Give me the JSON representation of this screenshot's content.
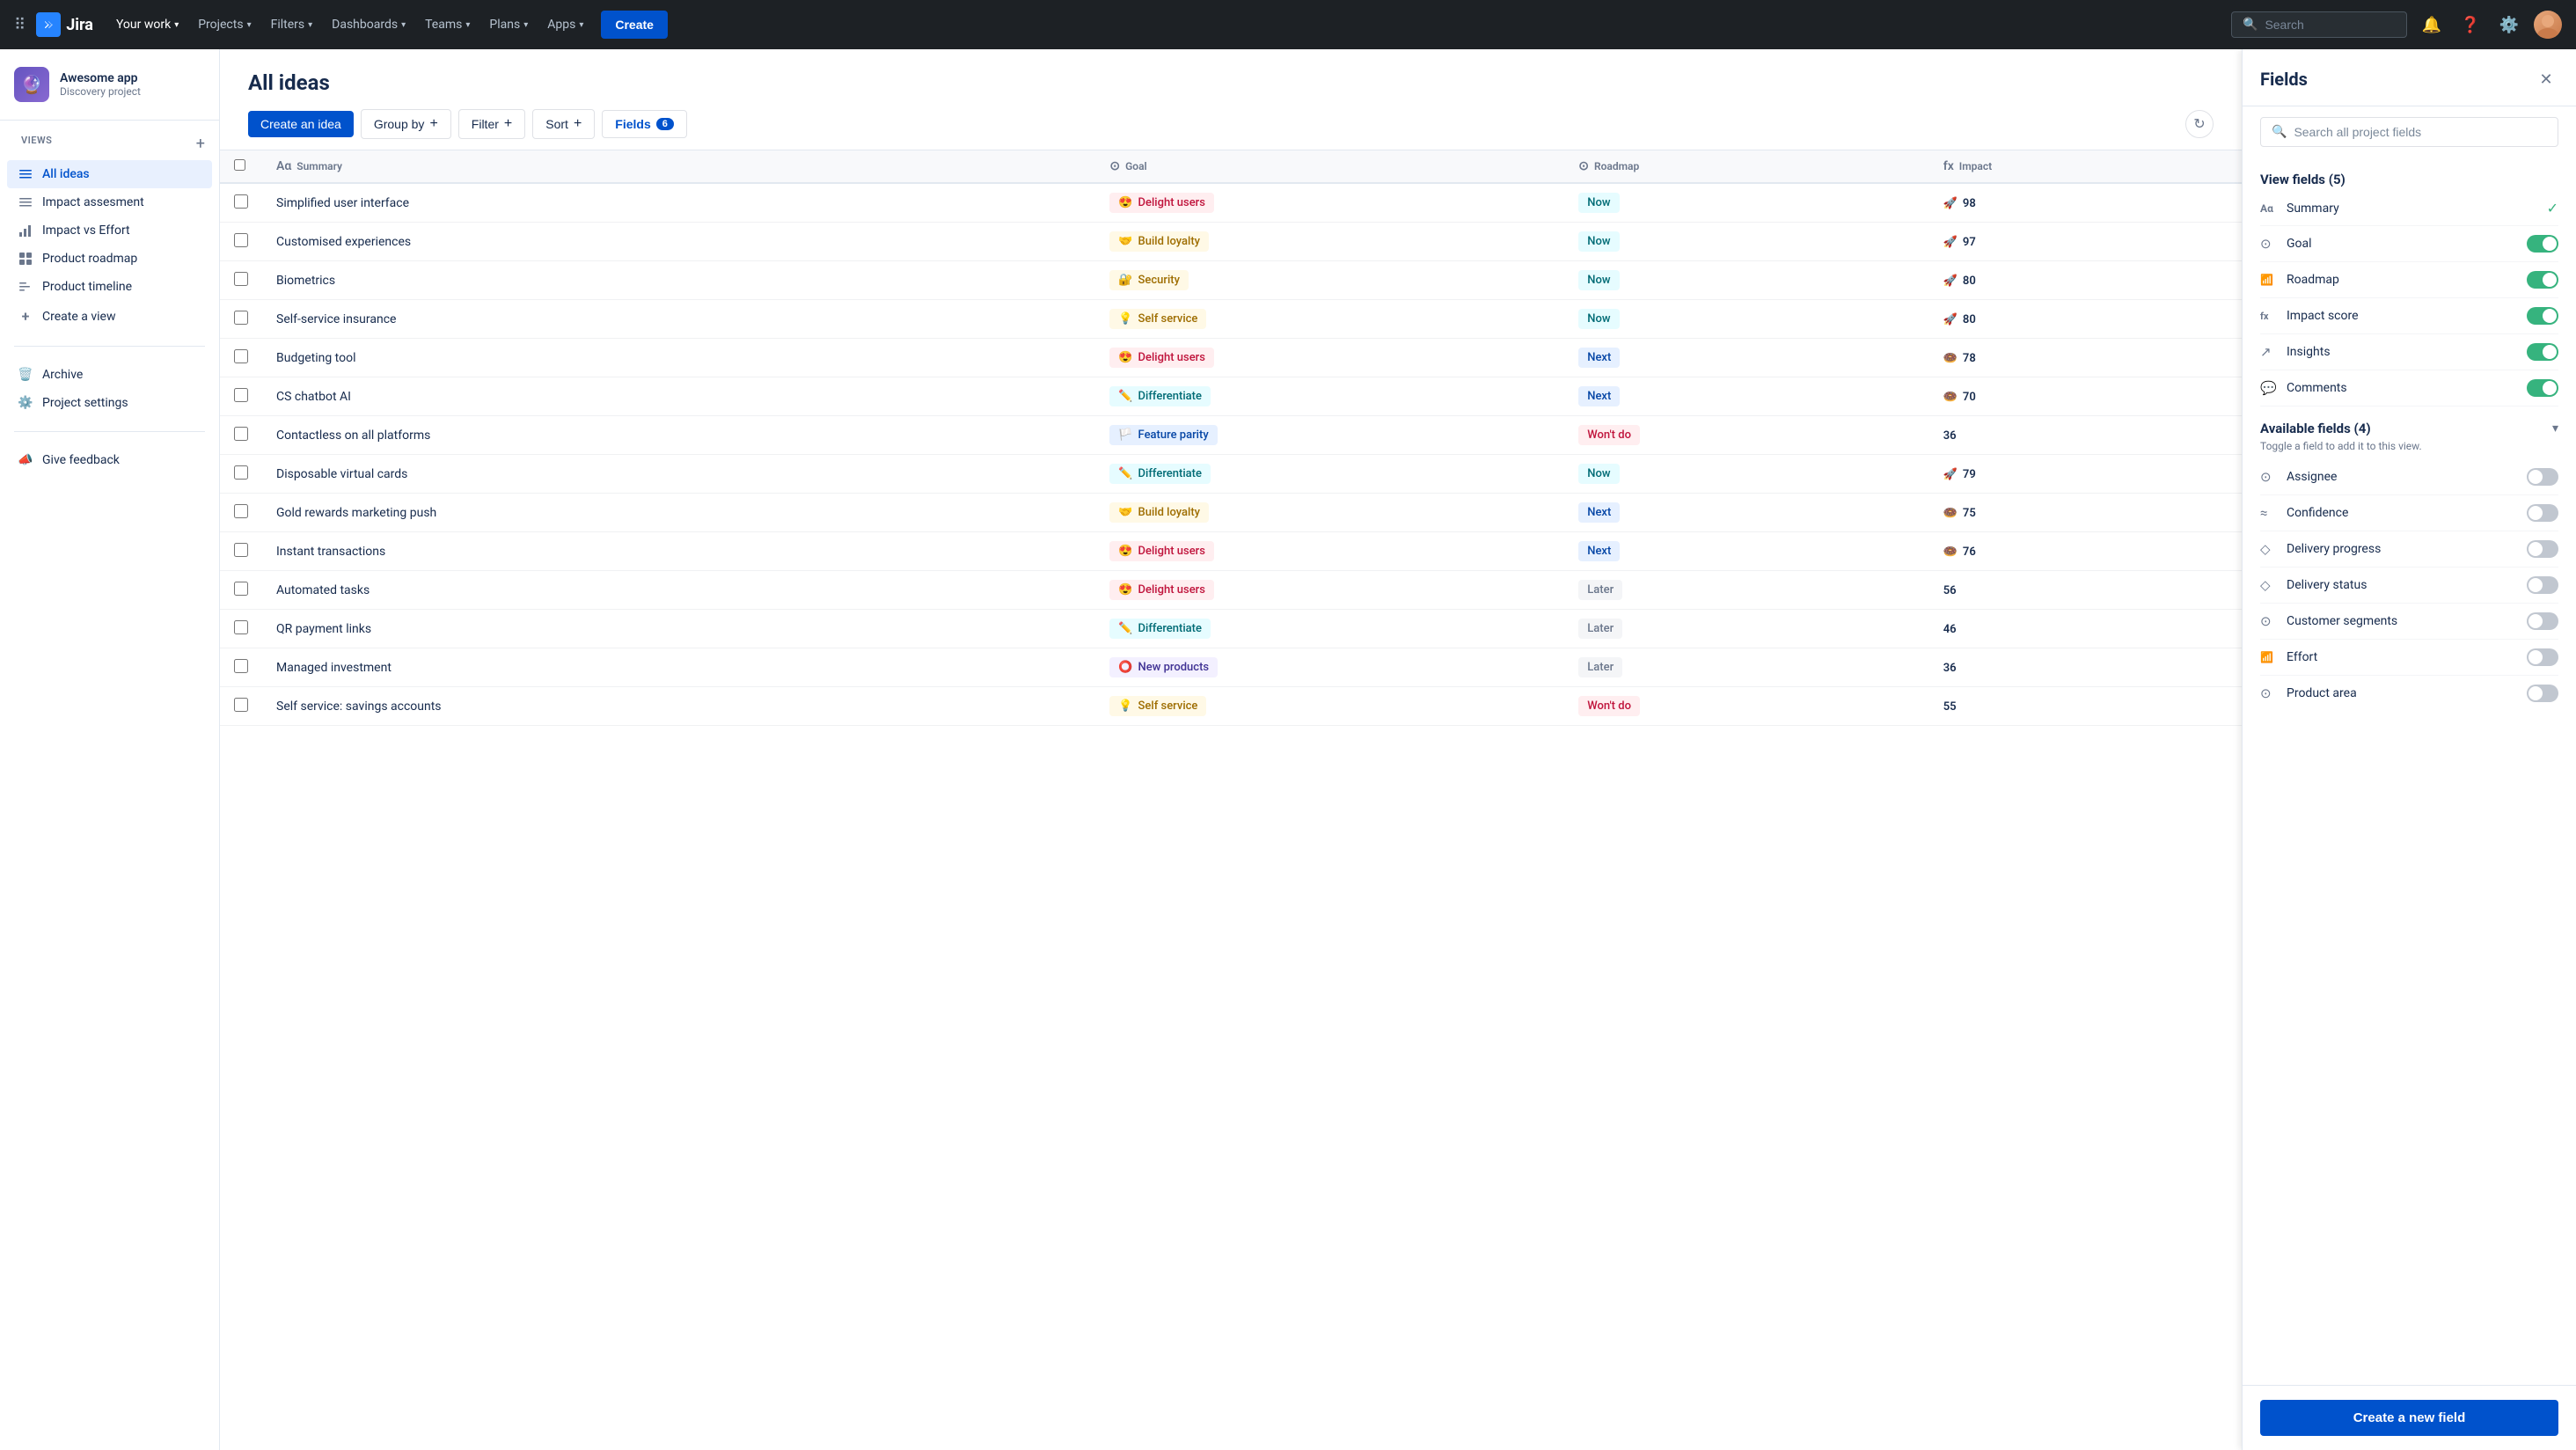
{
  "nav": {
    "logo_text": "Jira",
    "items": [
      {
        "label": "Your work",
        "has_dropdown": true
      },
      {
        "label": "Projects",
        "has_dropdown": true
      },
      {
        "label": "Filters",
        "has_dropdown": true
      },
      {
        "label": "Dashboards",
        "has_dropdown": true
      },
      {
        "label": "Teams",
        "has_dropdown": true
      },
      {
        "label": "Plans",
        "has_dropdown": true
      },
      {
        "label": "Apps",
        "has_dropdown": true
      }
    ],
    "create_label": "Create",
    "search_placeholder": "Search"
  },
  "sidebar": {
    "project_icon": "🔮",
    "project_name": "Awesome app",
    "project_type": "Discovery project",
    "views_label": "VIEWS",
    "views": [
      {
        "label": "All ideas",
        "icon": "☰",
        "active": true
      },
      {
        "label": "Impact assesment",
        "icon": "≡"
      },
      {
        "label": "Impact vs Effort",
        "icon": "📊"
      },
      {
        "label": "Product roadmap",
        "icon": "⊞"
      },
      {
        "label": "Product timeline",
        "icon": "≡"
      },
      {
        "label": "Create a view",
        "icon": "+"
      }
    ],
    "archive_label": "Archive",
    "archive_icon": "🗑",
    "settings_label": "Project settings",
    "settings_icon": "⚙",
    "feedback_label": "Give feedback",
    "feedback_icon": "📣"
  },
  "page": {
    "title": "All ideas",
    "toolbar": {
      "create_idea": "Create an idea",
      "group_by": "Group by",
      "filter": "Filter",
      "sort": "Sort",
      "fields": "Fields",
      "fields_count": "6"
    },
    "table": {
      "headers": [
        "Summary",
        "Goal",
        "Roadmap",
        "Impact"
      ],
      "rows": [
        {
          "summary": "Simplified user interface",
          "goal": "Delight users",
          "goal_class": "delight",
          "goal_emoji": "😍",
          "roadmap": "Now",
          "roadmap_class": "now",
          "impact": 98,
          "impact_icon": "🚀"
        },
        {
          "summary": "Customised experiences",
          "goal": "Build loyalty",
          "goal_class": "loyalty",
          "goal_emoji": "🤝",
          "roadmap": "Now",
          "roadmap_class": "now",
          "impact": 97,
          "impact_icon": "🚀"
        },
        {
          "summary": "Biometrics",
          "goal": "Security",
          "goal_class": "security",
          "goal_emoji": "🔐",
          "roadmap": "Now",
          "roadmap_class": "now",
          "impact": 80,
          "impact_icon": "🚀"
        },
        {
          "summary": "Self-service insurance",
          "goal": "Self service",
          "goal_class": "self",
          "goal_emoji": "💡",
          "roadmap": "Now",
          "roadmap_class": "now",
          "impact": 80,
          "impact_icon": "🚀"
        },
        {
          "summary": "Budgeting tool",
          "goal": "Delight users",
          "goal_class": "delight",
          "goal_emoji": "😍",
          "roadmap": "Next",
          "roadmap_class": "next",
          "impact": 78,
          "impact_icon": "🍩"
        },
        {
          "summary": "CS chatbot AI",
          "goal": "Differentiate",
          "goal_class": "diff",
          "goal_emoji": "✏️",
          "roadmap": "Next",
          "roadmap_class": "next",
          "impact": 70,
          "impact_icon": "🍩"
        },
        {
          "summary": "Contactless on all platforms",
          "goal": "Feature parity",
          "goal_class": "feature",
          "goal_emoji": "🏳️",
          "roadmap": "Won't do",
          "roadmap_class": "wont",
          "impact": 36,
          "impact_icon": ""
        },
        {
          "summary": "Disposable virtual cards",
          "goal": "Differentiate",
          "goal_class": "diff",
          "goal_emoji": "✏️",
          "roadmap": "Now",
          "roadmap_class": "now",
          "impact": 79,
          "impact_icon": "🚀"
        },
        {
          "summary": "Gold rewards marketing push",
          "goal": "Build loyalty",
          "goal_class": "loyalty",
          "goal_emoji": "🤝",
          "roadmap": "Next",
          "roadmap_class": "next",
          "impact": 75,
          "impact_icon": "🍩"
        },
        {
          "summary": "Instant transactions",
          "goal": "Delight users",
          "goal_class": "delight",
          "goal_emoji": "😍",
          "roadmap": "Next",
          "roadmap_class": "next",
          "impact": 76,
          "impact_icon": "🍩"
        },
        {
          "summary": "Automated tasks",
          "goal": "Delight users",
          "goal_class": "delight",
          "goal_emoji": "😍",
          "roadmap": "Later",
          "roadmap_class": "later",
          "impact": 56,
          "impact_icon": ""
        },
        {
          "summary": "QR payment links",
          "goal": "Differentiate",
          "goal_class": "diff",
          "goal_emoji": "✏️",
          "roadmap": "Later",
          "roadmap_class": "later",
          "impact": 46,
          "impact_icon": ""
        },
        {
          "summary": "Managed investment",
          "goal": "New products",
          "goal_class": "new",
          "goal_emoji": "⭕",
          "roadmap": "Later",
          "roadmap_class": "later",
          "impact": 36,
          "impact_icon": ""
        },
        {
          "summary": "Self service: savings accounts",
          "goal": "Self service",
          "goal_class": "self",
          "goal_emoji": "💡",
          "roadmap": "Won't do",
          "roadmap_class": "wont",
          "impact": 55,
          "impact_icon": ""
        }
      ]
    }
  },
  "fields_panel": {
    "title": "Fields",
    "search_placeholder": "Search all project fields",
    "view_fields_title": "View fields (5)",
    "view_fields": [
      {
        "label": "Summary",
        "icon": "Aα",
        "enabled": true,
        "check_only": true
      },
      {
        "label": "Goal",
        "icon": "⊙",
        "enabled": true
      },
      {
        "label": "Roadmap",
        "icon": "📊",
        "enabled": true
      },
      {
        "label": "Impact score",
        "icon": "fx",
        "enabled": true
      },
      {
        "label": "Insights",
        "icon": "↗",
        "enabled": true
      },
      {
        "label": "Comments",
        "icon": "💬",
        "enabled": true
      }
    ],
    "available_fields_title": "Available fields (4)",
    "available_subtitle": "Toggle a field to add it to this view.",
    "available_fields": [
      {
        "label": "Assignee",
        "icon": "⊙"
      },
      {
        "label": "Confidence",
        "icon": "≈"
      },
      {
        "label": "Delivery progress",
        "icon": "◇"
      },
      {
        "label": "Delivery status",
        "icon": "◇"
      },
      {
        "label": "Customer segments",
        "icon": "⊙"
      },
      {
        "label": "Effort",
        "icon": "📊"
      },
      {
        "label": "Product area",
        "icon": "⊙"
      }
    ],
    "create_new_field": "Create a new field"
  }
}
